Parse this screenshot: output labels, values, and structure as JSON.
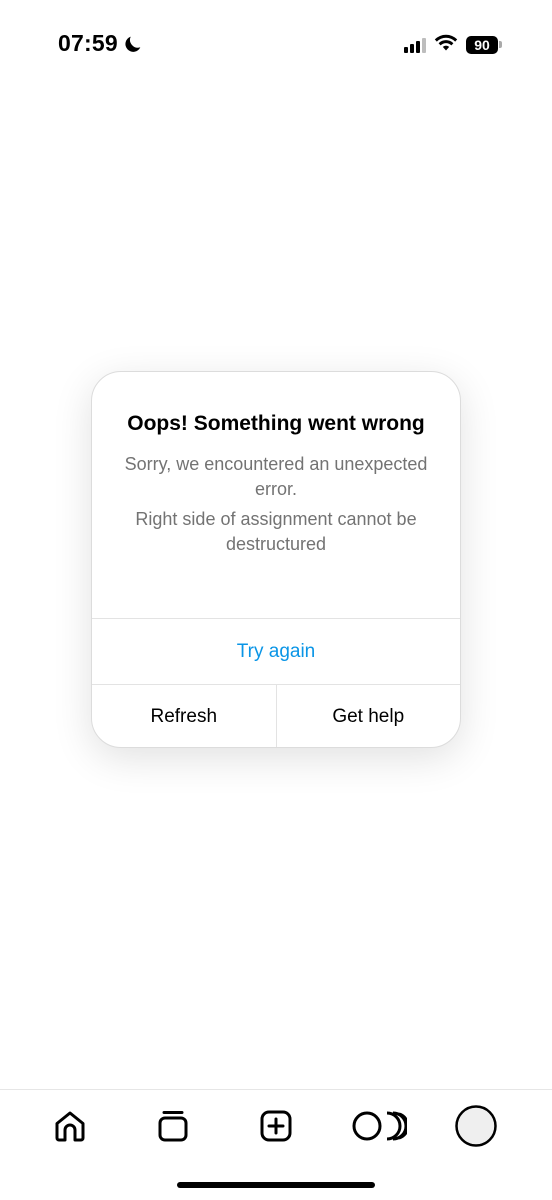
{
  "status_bar": {
    "time": "07:59",
    "battery": "90",
    "icons": [
      "moon-icon",
      "cellular-signal-icon",
      "wifi-icon",
      "battery-icon"
    ]
  },
  "dialog": {
    "title": "Oops! Something went wrong",
    "message": "Sorry, we encountered an unexpected error.",
    "detail": "Right side of assignment cannot be destructured",
    "primary_action": "Try again",
    "secondary_actions": [
      "Refresh",
      "Get help"
    ]
  },
  "colors": {
    "link_blue": "#0a95e6",
    "secondary_text": "#737373",
    "divider": "#e3e3e3"
  },
  "bottom_nav": {
    "items": [
      "home-icon",
      "feeds-icon",
      "create-icon",
      "threads-icon",
      "profile-avatar"
    ]
  }
}
